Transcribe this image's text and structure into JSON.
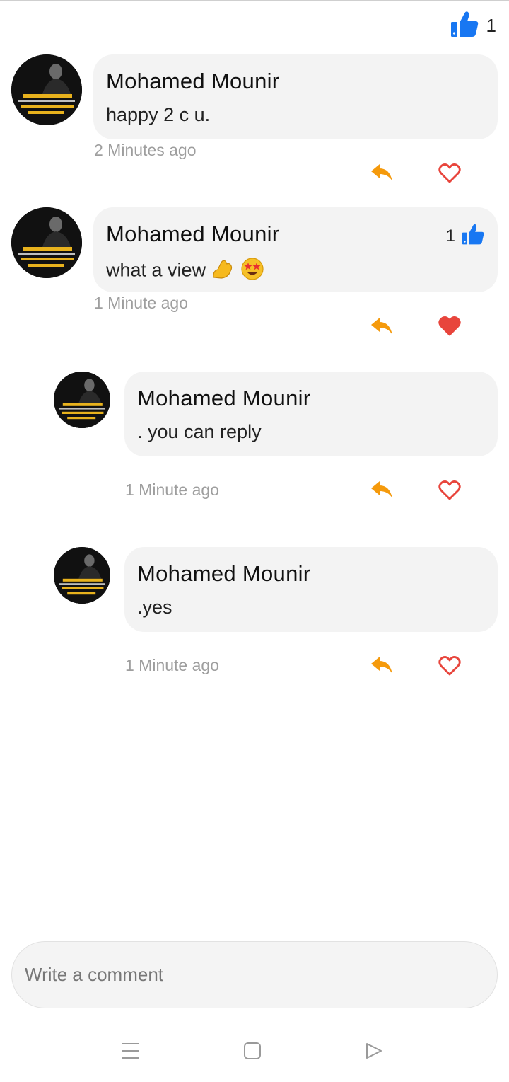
{
  "post": {
    "like_count": "1",
    "like_icon": "thumbs-up-icon",
    "accent_color": "#1877f2"
  },
  "comments": [
    {
      "author": "Mohamed Mounir",
      "text": "happy 2 c u.",
      "time": "2 Minutes ago",
      "liked": false
    },
    {
      "author": "Mohamed Mounir",
      "text": "what a view",
      "emojis": [
        "flexed-biceps-emoji",
        "star-struck-emoji"
      ],
      "time": "1 Minute ago",
      "like_count": "1",
      "liked": true,
      "replies": [
        {
          "author": "Mohamed Mounir",
          "text": ". you can reply",
          "time": "1 Minute ago",
          "liked": false
        },
        {
          "author": "Mohamed Mounir",
          "text": ".yes",
          "time": "1 Minute ago",
          "liked": false
        }
      ]
    }
  ],
  "composer": {
    "placeholder": "Write a comment"
  },
  "icons": {
    "reply": "reply-arrow-icon",
    "heart": "heart-icon",
    "reply_color": "#f59a0c",
    "heart_color": "#e8453c"
  },
  "navbar": {
    "items": [
      "menu-icon",
      "home-square-icon",
      "back-triangle-icon"
    ]
  }
}
